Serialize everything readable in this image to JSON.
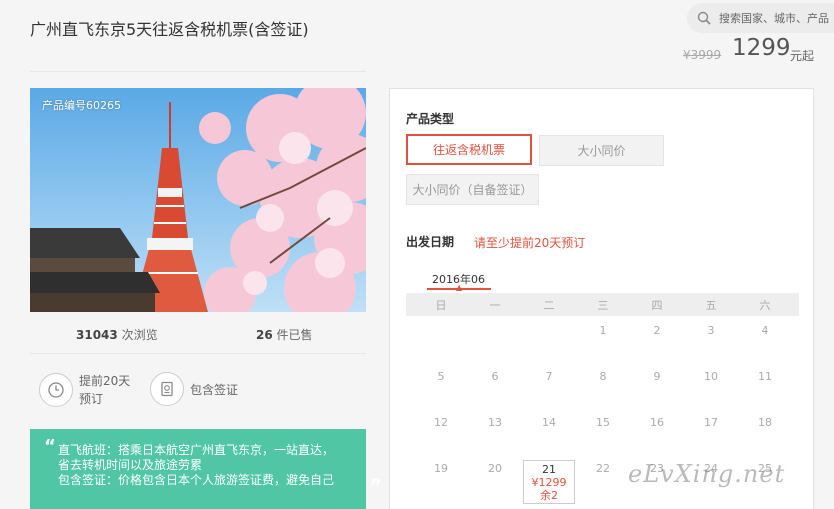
{
  "header": {
    "title": "广州直飞东京5天往返含税机票(含签证)",
    "search_placeholder": "搜索国家、城市、产品",
    "old_price": "¥3999",
    "price": "1299",
    "price_unit": "元起"
  },
  "product": {
    "number_label": "产品编号60265",
    "views_count": "31043",
    "views_label": "次浏览",
    "sold_count": "26",
    "sold_label": "件已售",
    "feature_advance_label": "提前20天预订",
    "feature_visa_label": "包含签证"
  },
  "highlights": {
    "line1": "直飞航班：搭乘日本航空广州直飞东京，一站直达，",
    "line2": "省去转机时间以及旅途劳累",
    "line3": "包含签证：价格包含日本个人旅游签证费，避免自己"
  },
  "booking": {
    "product_type_label": "产品类型",
    "options": [
      "往返含税机票",
      "大小同价",
      "大小同价（自备签证）"
    ],
    "selected_option_index": 0,
    "date_label": "出发日期",
    "advance_notice": "请至少提前20天预订",
    "month": "2016年06",
    "weekdays": [
      "日",
      "一",
      "二",
      "三",
      "四",
      "五",
      "六"
    ],
    "weeks": [
      [
        "",
        "",
        "",
        "1",
        "2",
        "3",
        "4"
      ],
      [
        "5",
        "6",
        "7",
        "8",
        "9",
        "10",
        "11"
      ],
      [
        "12",
        "13",
        "14",
        "15",
        "16",
        "17",
        "18"
      ],
      [
        "19",
        "20",
        "21",
        "22",
        "23",
        "24",
        "25"
      ]
    ],
    "available_day": {
      "day": "21",
      "price": "¥1299",
      "remaining": "余2"
    }
  },
  "watermark": "eLvXing.net",
  "colors": {
    "accent": "#e0533e",
    "green": "#50c6a4"
  }
}
